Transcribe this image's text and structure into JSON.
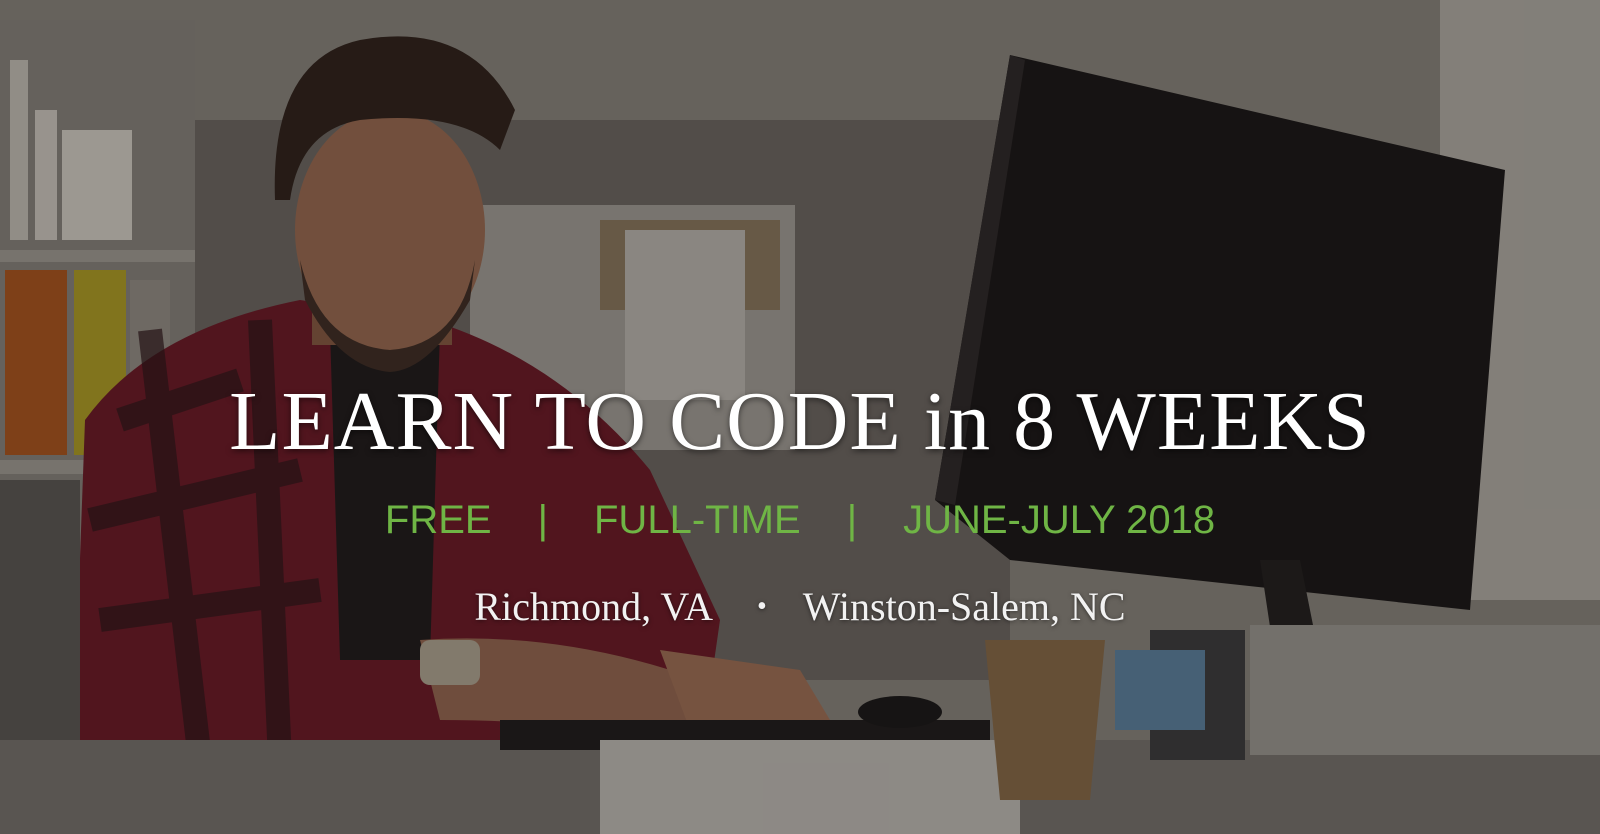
{
  "headline": "LEARN TO CODE in 8 WEEKS",
  "details": {
    "item1": "FREE",
    "sep": "|",
    "item2": "FULL-TIME",
    "item3": "JUNE-JULY 2018"
  },
  "locations": {
    "city1": "Richmond, VA",
    "dot": "•",
    "city2": "Winston-Salem, NC"
  },
  "colors": {
    "headline": "#ffffff",
    "details": "#6fb545",
    "locations": "#f2f2f2"
  }
}
